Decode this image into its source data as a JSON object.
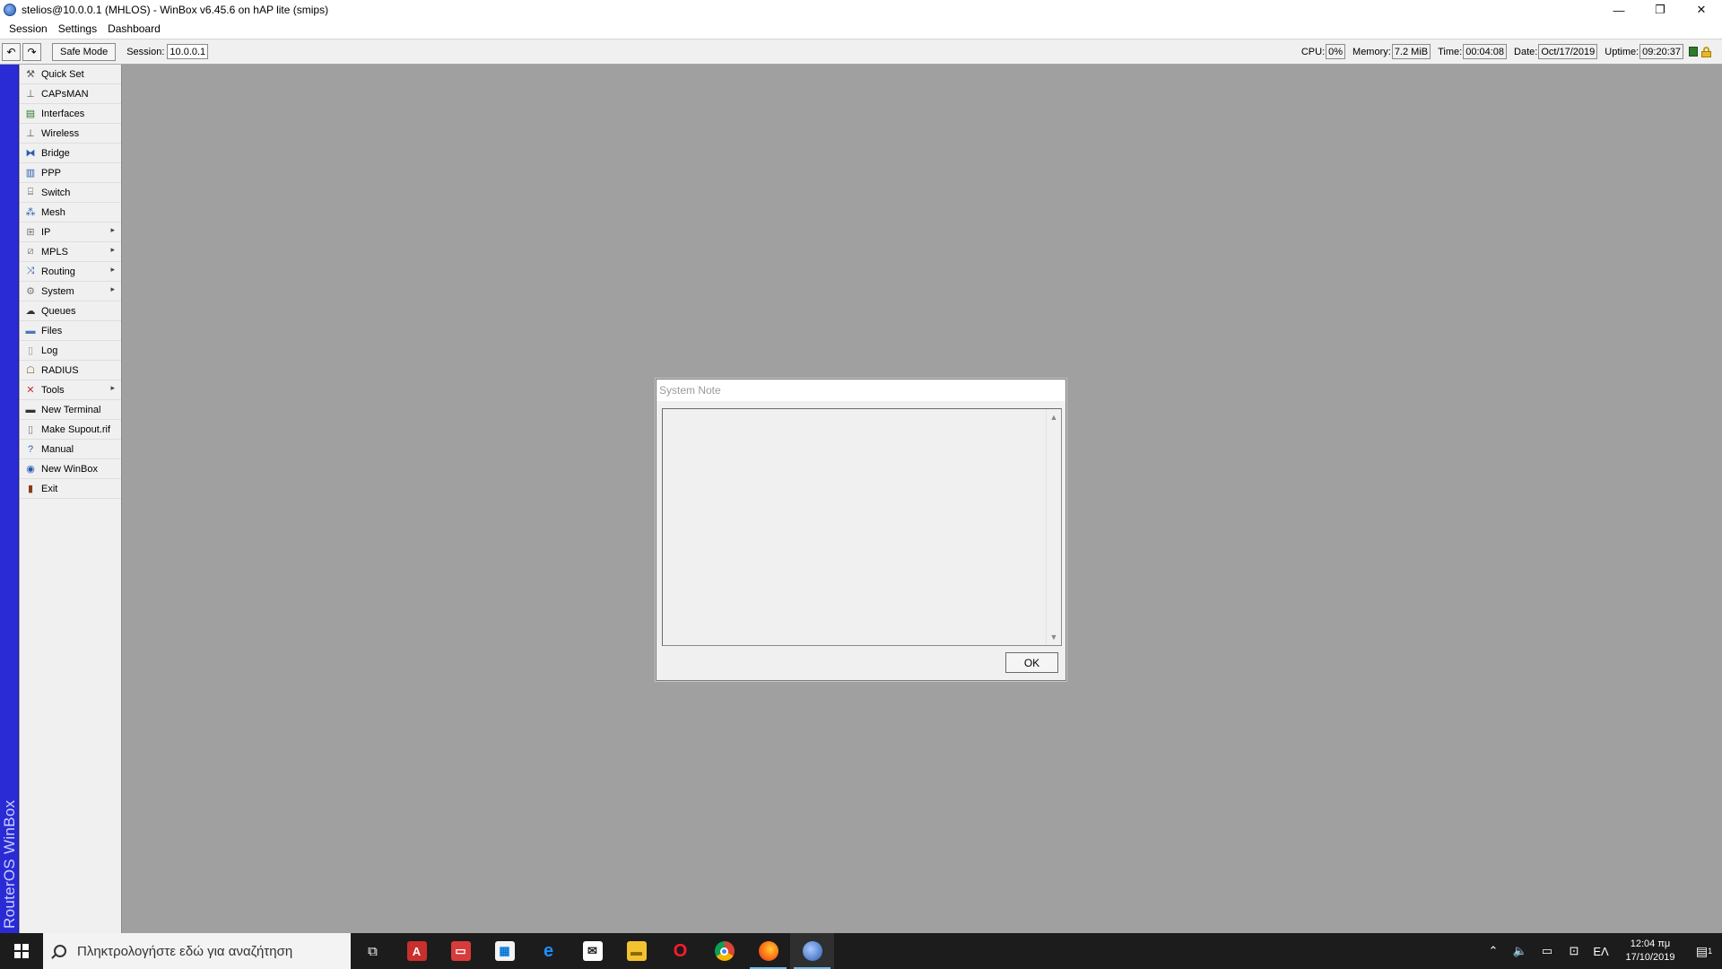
{
  "window": {
    "title": "stelios@10.0.0.1 (MHLOS) - WinBox v6.45.6 on hAP lite (smips)",
    "minimize": "—",
    "restore": "❐",
    "close": "✕"
  },
  "menu": [
    "Session",
    "Settings",
    "Dashboard"
  ],
  "toolbar": {
    "undo": "↶",
    "redo": "↷",
    "safe_mode": "Safe Mode",
    "session_label": "Session:",
    "session_value": "10.0.0.1",
    "cpu_label": "CPU:",
    "cpu_value": "0%",
    "memory_label": "Memory:",
    "memory_value": "7.2 MiB",
    "time_label": "Time:",
    "time_value": "00:04:08",
    "date_label": "Date:",
    "date_value": "Oct/17/2019",
    "uptime_label": "Uptime:",
    "uptime_value": "09:20:37"
  },
  "sidebar": {
    "brand": "RouterOS WinBox",
    "items": [
      {
        "label": "Quick Set",
        "icon": "quick-set-icon"
      },
      {
        "label": "CAPsMAN",
        "icon": "capsman-icon"
      },
      {
        "label": "Interfaces",
        "icon": "interfaces-icon"
      },
      {
        "label": "Wireless",
        "icon": "wireless-icon"
      },
      {
        "label": "Bridge",
        "icon": "bridge-icon"
      },
      {
        "label": "PPP",
        "icon": "ppp-icon"
      },
      {
        "label": "Switch",
        "icon": "switch-icon"
      },
      {
        "label": "Mesh",
        "icon": "mesh-icon"
      },
      {
        "label": "IP",
        "icon": "ip-icon",
        "submenu": true
      },
      {
        "label": "MPLS",
        "icon": "mpls-icon",
        "submenu": true
      },
      {
        "label": "Routing",
        "icon": "routing-icon",
        "submenu": true
      },
      {
        "label": "System",
        "icon": "system-icon",
        "submenu": true
      },
      {
        "label": "Queues",
        "icon": "queues-icon"
      },
      {
        "label": "Files",
        "icon": "files-icon"
      },
      {
        "label": "Log",
        "icon": "log-icon"
      },
      {
        "label": "RADIUS",
        "icon": "radius-icon"
      },
      {
        "label": "Tools",
        "icon": "tools-icon",
        "submenu": true
      },
      {
        "label": "New Terminal",
        "icon": "terminal-icon"
      },
      {
        "label": "Make Supout.rif",
        "icon": "supout-icon"
      },
      {
        "label": "Manual",
        "icon": "manual-icon"
      },
      {
        "label": "New WinBox",
        "icon": "winbox-icon"
      },
      {
        "label": "Exit",
        "icon": "exit-icon"
      }
    ]
  },
  "dialog": {
    "title": "System Note",
    "text": "",
    "ok_label": "OK"
  },
  "taskbar": {
    "search_placeholder": "Πληκτρολογήστε εδώ για αναζήτηση",
    "language": "ΕΛ",
    "time": "12:04 πμ",
    "date": "17/10/2019",
    "notification_count": "1"
  },
  "colors": {
    "sidebar_stripe": "#2b2bd6",
    "workspace": "#a0a0a0",
    "taskbar": "#1c1c1c"
  }
}
